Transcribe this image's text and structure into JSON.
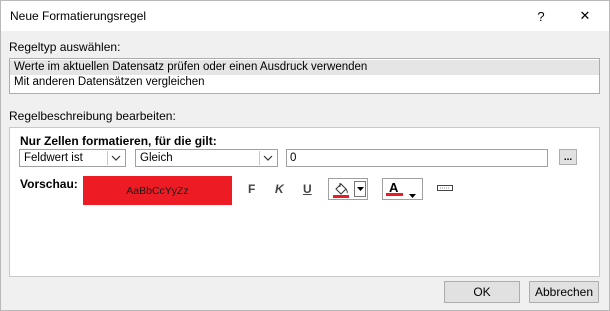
{
  "window": {
    "title": "Neue Formatierungsregel",
    "help": "?",
    "close": "✕"
  },
  "rule_type": {
    "label": "Regeltyp auswählen:",
    "items": [
      "Werte im aktuellen Datensatz prüfen oder einen Ausdruck verwenden",
      "Mit anderen Datensätzen vergleichen"
    ],
    "selected_index": 0
  },
  "rule_description": {
    "label": "Regelbeschreibung bearbeiten:",
    "condition_heading": "Nur Zellen formatieren, für die gilt:",
    "field_combo": "Feldwert ist",
    "operator_combo": "Gleich",
    "value_input": "0",
    "expr_button": "...",
    "preview_label": "Vorschau:",
    "preview_text": "AaBbCcYyZz",
    "preview_color": "#ed1c24",
    "bold_label": "F",
    "italic_label": "K",
    "underline_label": "U",
    "fill_color_icon": "paint-bucket-icon",
    "font_color_letter": "A",
    "font_color_swatch": "#ed1c24",
    "enable_icon": "enable-format-icon"
  },
  "buttons": {
    "ok": "OK",
    "cancel": "Abbrechen"
  }
}
